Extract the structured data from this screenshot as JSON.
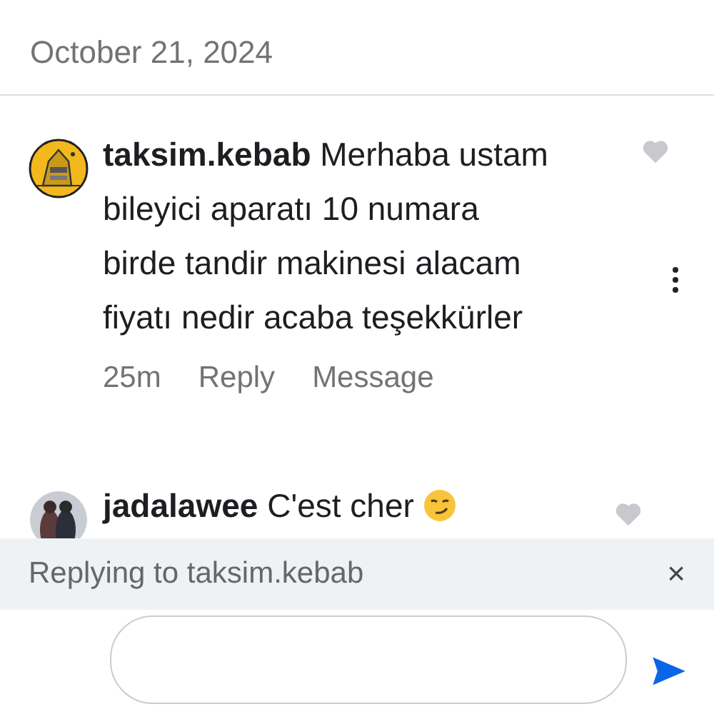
{
  "post": {
    "date": "October 21, 2024"
  },
  "comments": [
    {
      "kind": "full",
      "username": "taksim.kebab",
      "text": "Merhaba ustam bileyici aparatı 10 numara birde tandir makinesi alacam fiyatı nedir acaba teşekkürler",
      "time": "25m",
      "actions": [
        "Reply",
        "Message"
      ],
      "liked": false
    },
    {
      "kind": "partial",
      "username": "jadalawee",
      "text": "C'est cher",
      "liked": false
    }
  ],
  "reply_bar": {
    "text": "Replying to taksim.kebab",
    "close": "×"
  }
}
